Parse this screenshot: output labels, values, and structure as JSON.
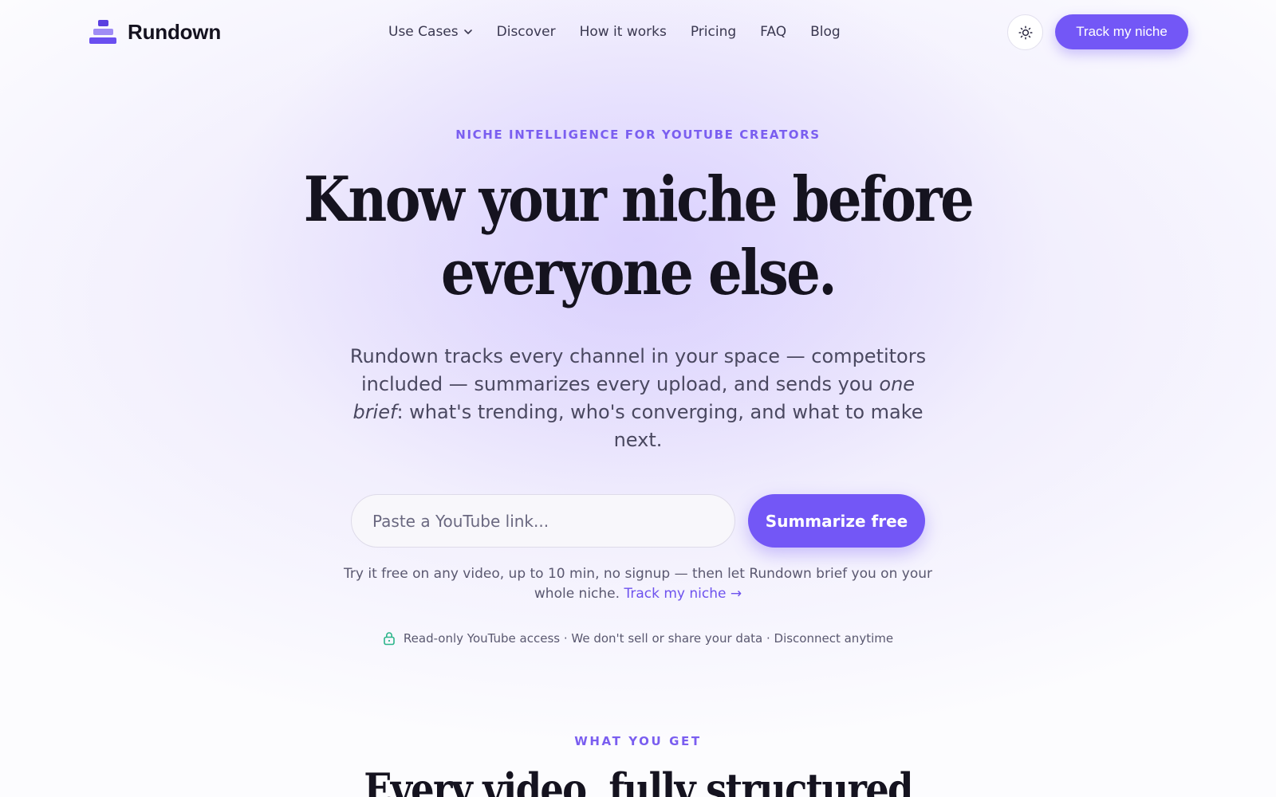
{
  "brand": {
    "name": "Rundown"
  },
  "nav": {
    "items": [
      {
        "label": "Use Cases",
        "has_dropdown": true
      },
      {
        "label": "Discover"
      },
      {
        "label": "How it works"
      },
      {
        "label": "Pricing"
      },
      {
        "label": "FAQ"
      },
      {
        "label": "Blog"
      }
    ],
    "theme_toggle_icon": "sun-icon",
    "cta_label": "Track my niche"
  },
  "hero": {
    "eyebrow": "NICHE INTELLIGENCE FOR YOUTUBE CREATORS",
    "headline_line1": "Know your niche before",
    "headline_line2": "everyone else.",
    "subcopy_part1": "Rundown tracks every channel in your space — competitors included — summarizes every upload, and sends you ",
    "subcopy_emphasis": "one brief",
    "subcopy_part2": ": what's trending, who's converging, and what to make next.",
    "input_placeholder": "Paste a YouTube link...",
    "input_value": "",
    "submit_label": "Summarize free",
    "trial_note": "Try it free on any video, up to 10 min, no signup — then let Rundown brief you on your whole niche. ",
    "trial_link": "Track my niche →",
    "trust_icon": "lock-icon",
    "trust_text": "Read-only YouTube access · We don't sell or share your data · Disconnect anytime"
  },
  "features": {
    "eyebrow": "WHAT YOU GET",
    "title": "Every video, fully structured"
  },
  "colors": {
    "accent": "#7357f6",
    "accent_text": "#7a5ef0",
    "trust_icon": "#2bb58a"
  }
}
